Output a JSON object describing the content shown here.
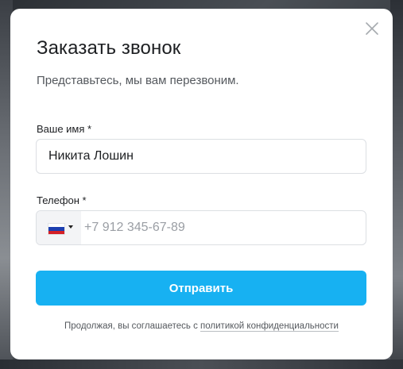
{
  "modal": {
    "title": "Заказать звонок",
    "subtitle": "Представьтесь, мы вам перезвоним.",
    "close_icon": "close-icon"
  },
  "form": {
    "name": {
      "label": "Ваше имя *",
      "value": "Никита Лошин"
    },
    "phone": {
      "label": "Телефон *",
      "value": "",
      "placeholder": "+7 912 345-67-89",
      "country_icon": "russia-flag-icon",
      "caret_icon": "caret-down-icon"
    },
    "submit_label": "Отправить"
  },
  "consent": {
    "prefix": "Продолжая, вы соглашаетесь с ",
    "link_text": "политикой конфиденциальности"
  },
  "colors": {
    "accent": "#17b1f2",
    "text": "#1d1f22",
    "muted": "#55595e",
    "border": "#dcdfe3",
    "placeholder": "#9a9ea4"
  }
}
